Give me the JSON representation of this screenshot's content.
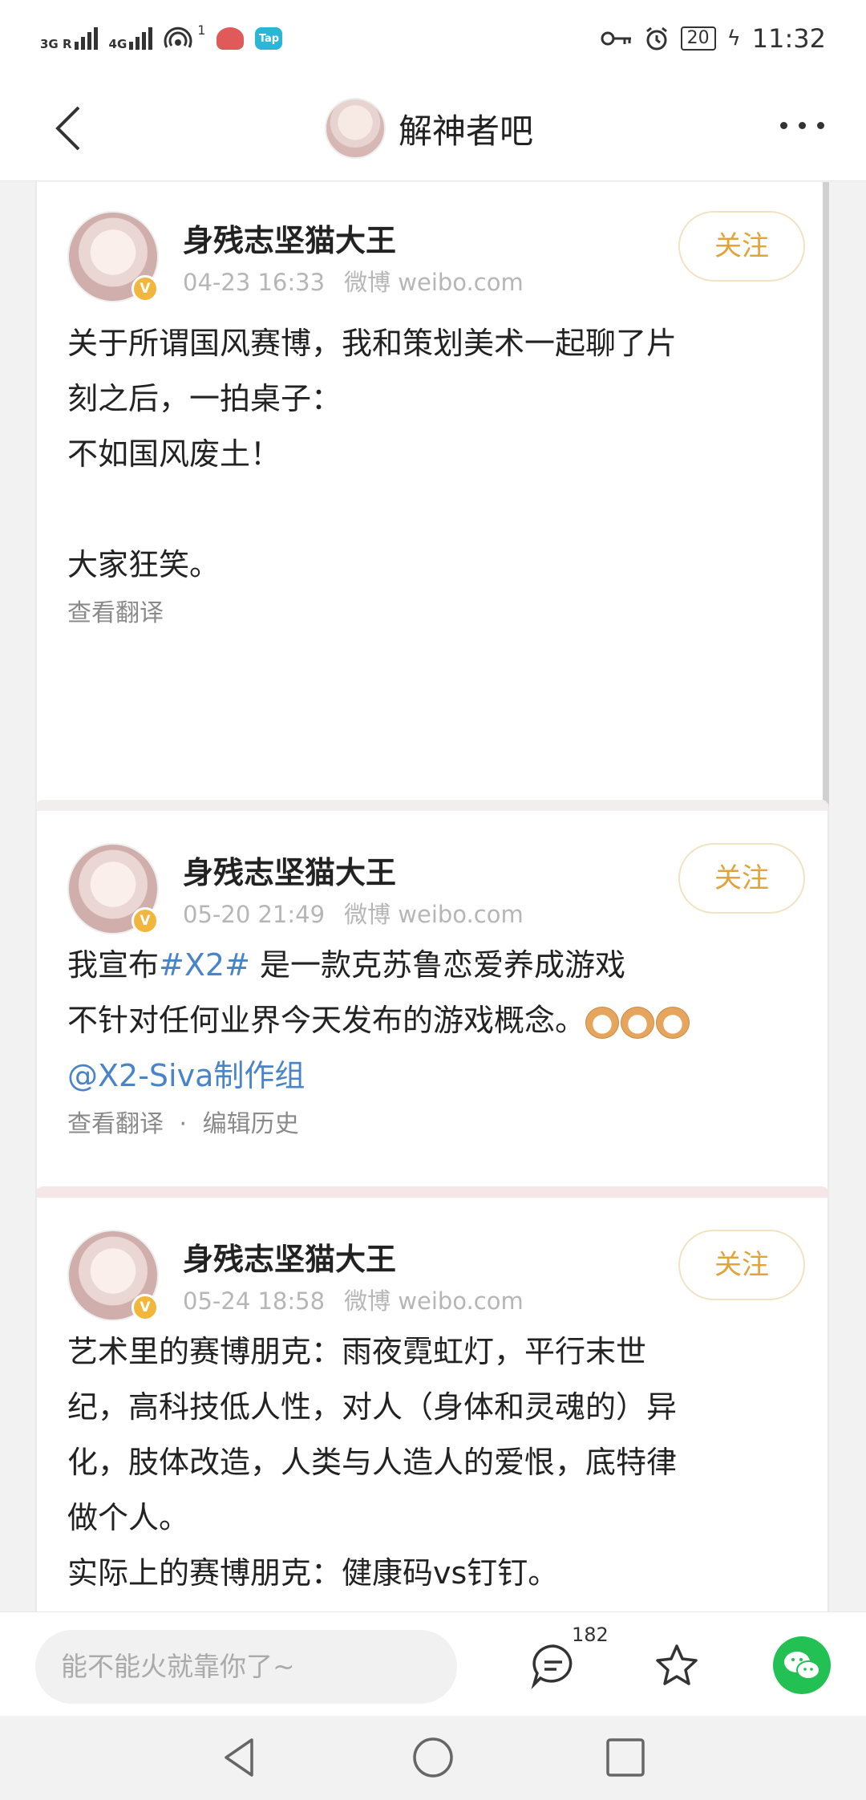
{
  "status_bar": {
    "signal1_label": "3G R",
    "signal2_label": "4G",
    "notification_count": "1",
    "tap_app_label": "Tap",
    "battery": "20",
    "time": "11:32"
  },
  "header": {
    "title": "解神者吧"
  },
  "posts": [
    {
      "username": "身残志坚猫大王",
      "date": "04-23 16:33",
      "source": "微博 weibo.com",
      "follow_label": "关注",
      "lines": [
        "关于所谓国风赛博，我和策划美术一起聊了片",
        "刻之后，一拍桌子：",
        "不如国风废土！",
        "",
        "大家狂笑。"
      ],
      "translate_label": "查看翻译"
    },
    {
      "username": "身残志坚猫大王",
      "date": "05-20 21:49",
      "source": "微博 weibo.com",
      "follow_label": "关注",
      "line1_prefix": "我宣布",
      "hashtag": "#X2#",
      "line1_suffix": " 是一款克苏鲁恋爱养成游戏",
      "line2": "不针对任何业界今天发布的游戏概念。",
      "mention": "@X2-Siva制作组",
      "translate_label": "查看翻译",
      "dot": "·",
      "edit_history_label": "编辑历史"
    },
    {
      "username": "身残志坚猫大王",
      "date": "05-24 18:58",
      "source": "微博 weibo.com",
      "follow_label": "关注",
      "lines": [
        "艺术里的赛博朋克：雨夜霓虹灯，平行末世",
        "纪，高科技低人性，对人（身体和灵魂的）异",
        "化，肢体改造，人类与人造人的爱恨，底特律",
        "做个人。",
        "实际上的赛博朋克：健康码vs钉钉。"
      ]
    }
  ],
  "input_bar": {
    "placeholder": "能不能火就靠你了~",
    "comment_count": "182"
  },
  "colors": {
    "accent_gold": "#e0a43a",
    "link_blue": "#4a84c8",
    "wechat_green": "#23c053"
  }
}
